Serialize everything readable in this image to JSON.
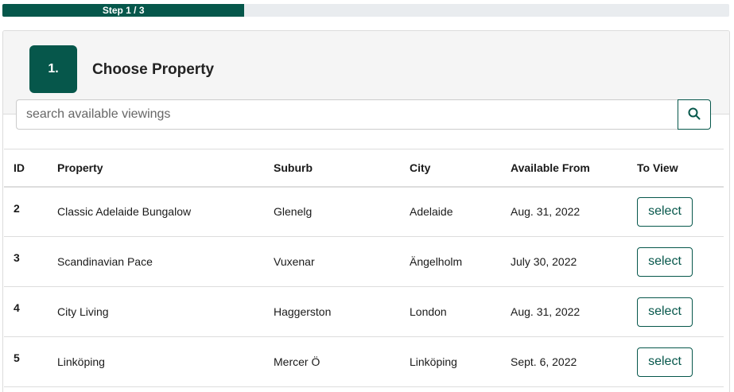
{
  "progress": {
    "label": "Step 1 / 3",
    "fraction": 0.333,
    "color": "#06574b"
  },
  "step": {
    "number": "1.",
    "title": "Choose Property"
  },
  "search": {
    "placeholder": "search available viewings",
    "icon": "search-icon"
  },
  "table": {
    "headers": [
      "ID",
      "Property",
      "Suburb",
      "City",
      "Available From",
      "To View"
    ],
    "rows": [
      {
        "id": "2",
        "property": "Classic Adelaide Bungalow",
        "suburb": "Glenelg",
        "city": "Adelaide",
        "available": "Aug. 31, 2022",
        "action": "select"
      },
      {
        "id": "3",
        "property": "Scandinavian Pace",
        "suburb": "Vuxenar",
        "city": "Ängelholm",
        "available": "July 30, 2022",
        "action": "select"
      },
      {
        "id": "4",
        "property": "City Living",
        "suburb": "Haggerston",
        "city": "London",
        "available": "Aug. 31, 2022",
        "action": "select"
      },
      {
        "id": "5",
        "property": "Linköping",
        "suburb": "Mercer Ö",
        "city": "Linköping",
        "available": "Sept. 6, 2022",
        "action": "select"
      }
    ]
  },
  "colors": {
    "brand": "#06574b",
    "header_bg": "#f5f5f5",
    "track": "#e9ecef"
  }
}
